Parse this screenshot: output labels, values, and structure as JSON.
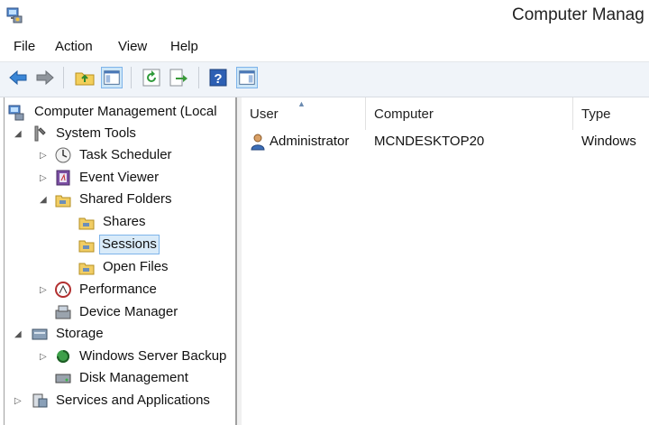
{
  "window": {
    "title": "Computer Manag",
    "app_icon": "computer-management-icon"
  },
  "menu": [
    "File",
    "Action",
    "View",
    "Help"
  ],
  "toolbar": [
    {
      "name": "back-button",
      "icon": "arrow-left-icon"
    },
    {
      "name": "forward-button",
      "icon": "arrow-right-icon"
    },
    {
      "name": "up-one-level-button",
      "icon": "folder-up-icon"
    },
    {
      "name": "show-hide-console-tree-button",
      "icon": "console-tree-icon",
      "selected": true
    },
    {
      "name": "refresh-button",
      "icon": "refresh-icon"
    },
    {
      "name": "export-list-button",
      "icon": "export-icon"
    },
    {
      "name": "help-button",
      "icon": "help-icon"
    },
    {
      "name": "show-hide-action-pane-button",
      "icon": "action-pane-icon",
      "selected": true
    }
  ],
  "tree": {
    "root": "Computer Management (Local",
    "system_tools": "System Tools",
    "task_scheduler": "Task Scheduler",
    "event_viewer": "Event Viewer",
    "shared_folders": "Shared Folders",
    "shares": "Shares",
    "sessions": "Sessions",
    "open_files": "Open Files",
    "performance": "Performance",
    "device_manager": "Device Manager",
    "storage": "Storage",
    "windows_server_backup": "Windows Server Backup",
    "disk_management": "Disk Management",
    "services_and_applications": "Services and Applications",
    "selected": "Sessions"
  },
  "list": {
    "columns": [
      "User",
      "Computer",
      "Type"
    ],
    "sorted_column": "User",
    "rows": [
      {
        "user": "Administrator",
        "computer": "MCNDESKTOP20",
        "type": "Windows"
      }
    ]
  },
  "colors": {
    "toolbar_bg": "#f0f4f9",
    "selection_border": "#7eb4ea",
    "selection_bg": "#d9ebf9"
  }
}
